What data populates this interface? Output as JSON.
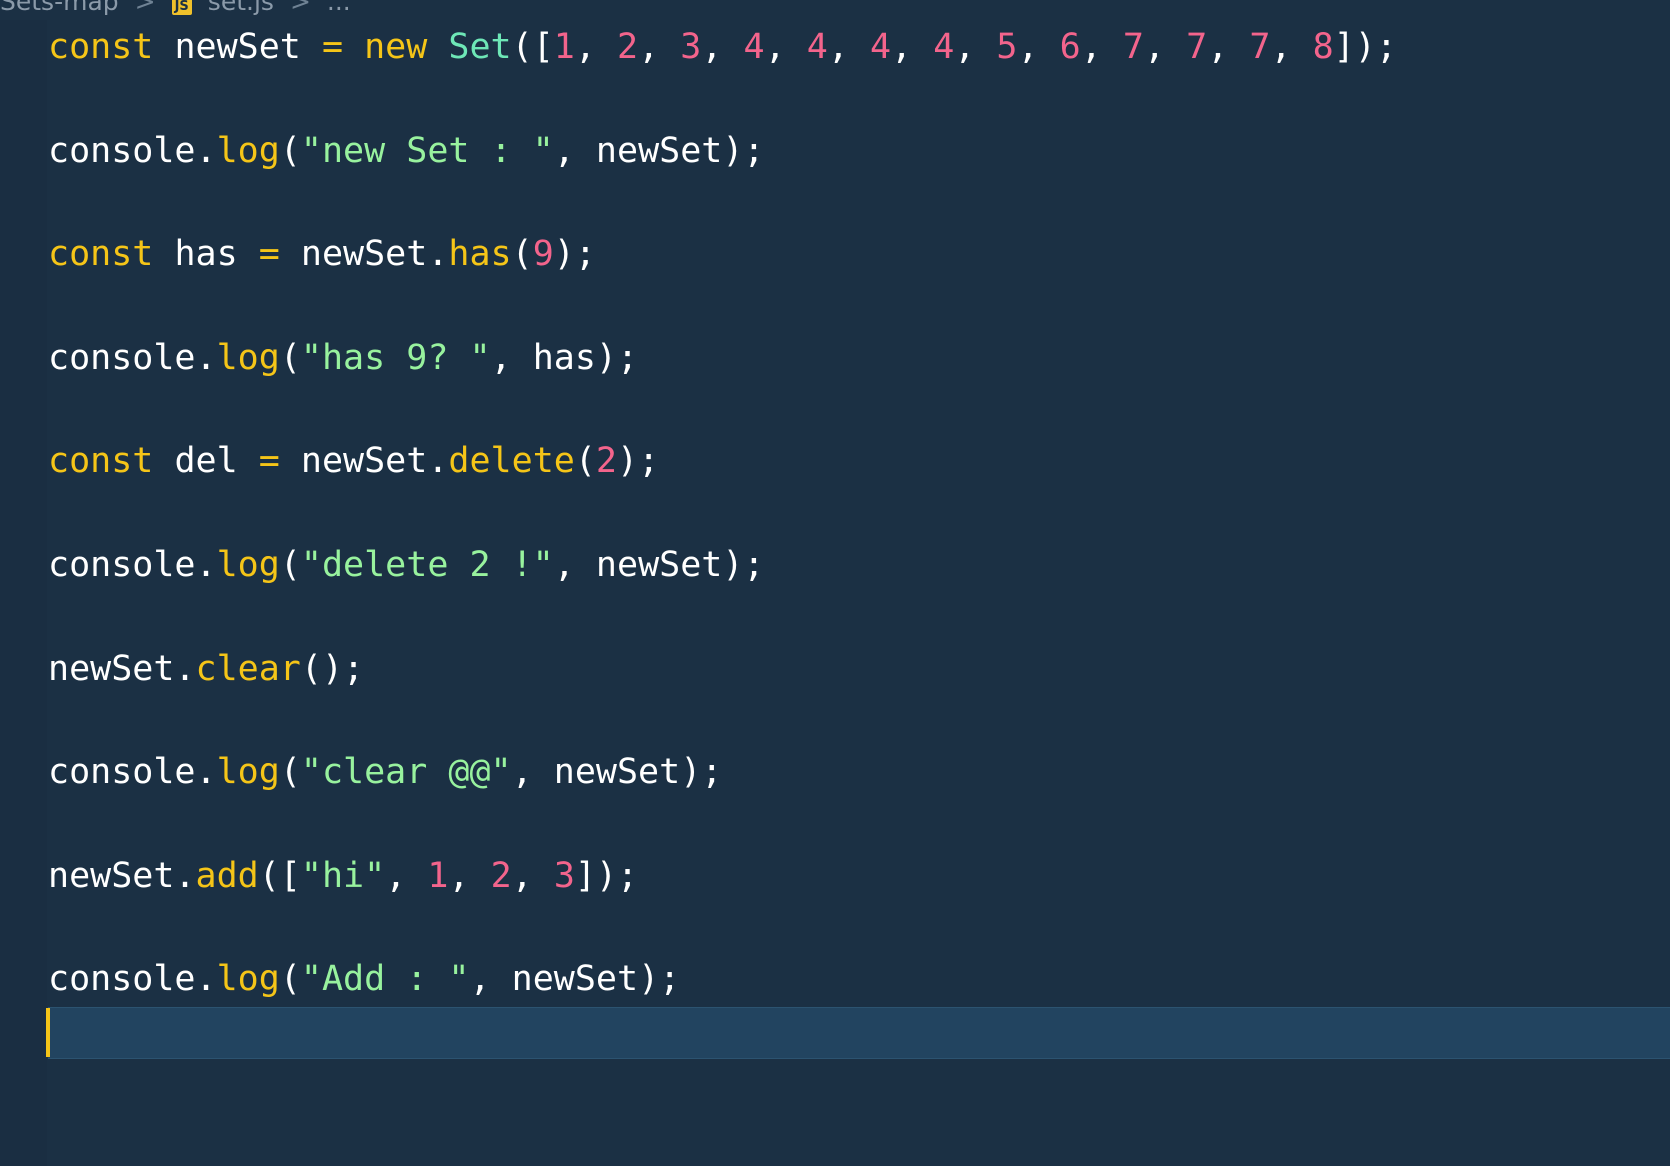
{
  "breadcrumb": {
    "folder": "Sets-map",
    "sep1": ">",
    "file_badge": "JS",
    "file": "set.js",
    "sep2": ">",
    "more": "..."
  },
  "code_tokens": {
    "const": "const",
    "new": "new",
    "eq": "=",
    "Set": "Set",
    "console": "console",
    "dot": ".",
    "log": "log",
    "has": "has",
    "delete": "delete",
    "clear": "clear",
    "add": "add",
    "newSet": "newSet",
    "has_var": "has",
    "del_var": "del"
  },
  "lines": [
    "const newSet = new Set([1, 2, 3, 4, 4, 4, 4, 5, 6, 7, 7, 7, 8]);",
    "console.log(\"new Set : \", newSet);",
    "const has = newSet.has(9);",
    "console.log(\"has 9? \", has);",
    "const del = newSet.delete(2);",
    "console.log(\"delete 2 !\", newSet);",
    "newSet.clear();",
    "console.log(\"clear @@\", newSet);",
    "newSet.add([\"hi\", 1, 2, 3]);",
    "console.log(\"Add : \", newSet);"
  ],
  "strings": {
    "s1": "\"new Set : \"",
    "s2": "\"has 9? \"",
    "s3": "\"delete 2 !\"",
    "s4": "\"clear @@\"",
    "s5": "\"hi\"",
    "s6": "\"Add : \""
  },
  "numbers": {
    "set_init": [
      "1",
      "2",
      "3",
      "4",
      "4",
      "4",
      "4",
      "5",
      "6",
      "7",
      "7",
      "7",
      "8"
    ],
    "has_arg": "9",
    "delete_arg": "2",
    "add_nums": [
      "1",
      "2",
      "3"
    ]
  },
  "colors": {
    "background": "#1b3044",
    "keyword": "#f5c518",
    "class": "#6ee7b7",
    "number": "#f3648c",
    "string": "#98f29e",
    "plain": "#ffffff",
    "cursor": "#f5c518"
  }
}
